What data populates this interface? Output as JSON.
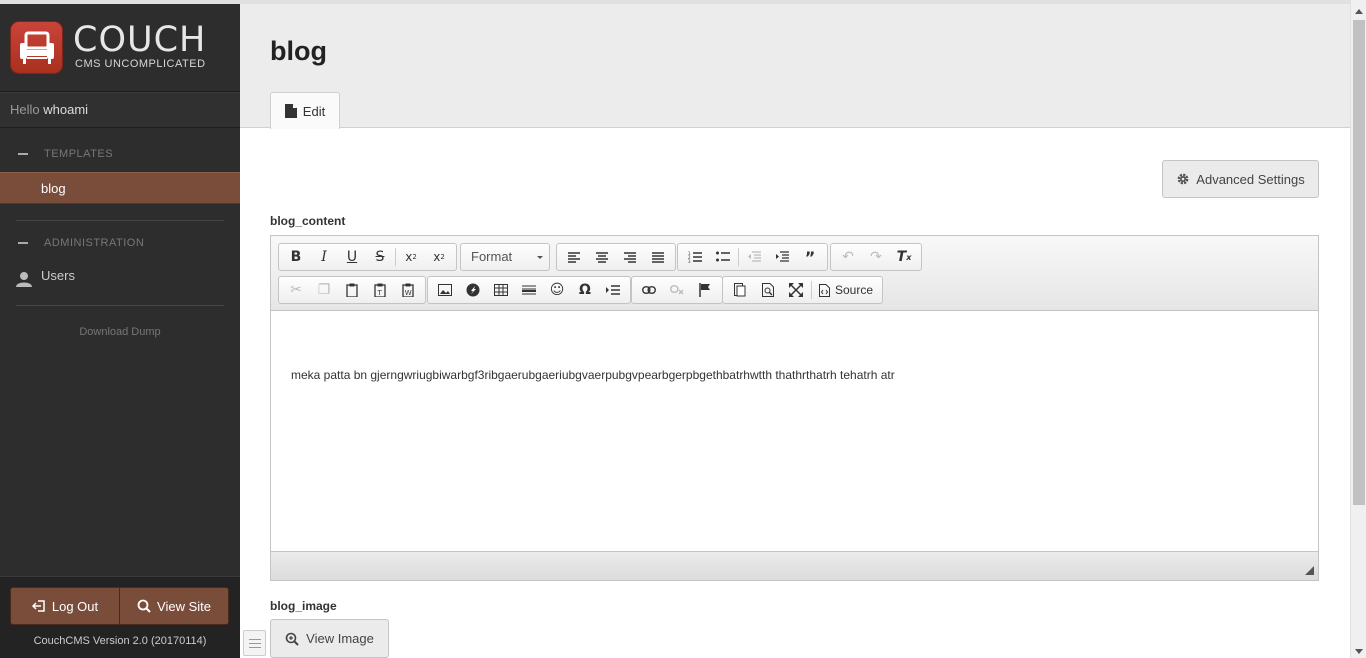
{
  "brand": {
    "title": "COUCH",
    "subtitle": "CMS UNCOMPLICATED"
  },
  "user": {
    "greeting": "Hello",
    "name": "whoami"
  },
  "sidebar": {
    "templates_heading": "TEMPLATES",
    "templates": [
      {
        "label": "blog",
        "active": true
      }
    ],
    "admin_heading": "ADMINISTRATION",
    "admin_items": [
      {
        "label": "Users",
        "icon": "user-icon"
      }
    ],
    "download_link": "Download Dump",
    "logout_label": "Log Out",
    "viewsite_label": "View Site",
    "version": "CouchCMS Version 2.0 (20170114)"
  },
  "page": {
    "title": "blog",
    "tab_edit": "Edit",
    "advanced_settings": "Advanced Settings"
  },
  "fields": {
    "content_label": "blog_content",
    "content_text": "meka patta bn gjerngwriugbiwarbgf3ribgaerubgaeriubgvaerpubgvpearbgerpbgethbatrhwtth thathrthatrh tehatrh atr",
    "image_label": "blog_image",
    "view_image": "View Image"
  },
  "toolbar": {
    "format_label": "Format",
    "source_label": "Source"
  },
  "colors": {
    "sidebar_bg": "#2d2d2d",
    "accent": "#7a4d3a",
    "logo_red": "#c9443a"
  }
}
